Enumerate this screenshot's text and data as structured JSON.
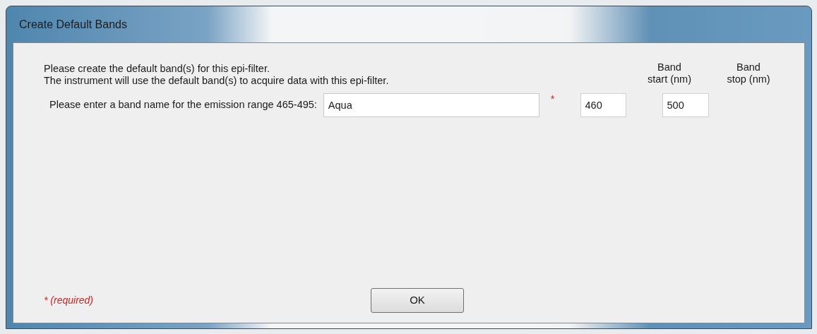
{
  "window": {
    "title": "Create Default Bands"
  },
  "instructions": [
    "Please create the default band(s) for this epi-filter.",
    "The instrument will use the default band(s) to acquire data with this epi-filter."
  ],
  "columns": [
    {
      "line1": "Band",
      "line2": "start (nm)"
    },
    {
      "line1": "Band",
      "line2": "stop (nm)"
    }
  ],
  "band": {
    "label": "Please enter a band name for the emission range 465-495:",
    "name": "Aqua",
    "required_mark": "*",
    "start": "460",
    "stop": "500"
  },
  "footer": {
    "required_note": "* (required)",
    "ok_button": "OK"
  }
}
